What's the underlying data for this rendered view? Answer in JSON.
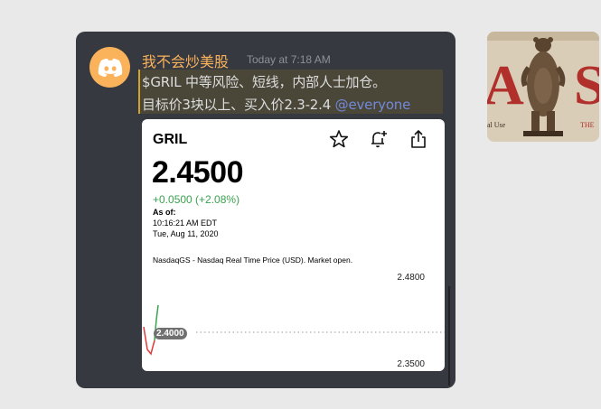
{
  "message": {
    "username": "我不会炒美股",
    "timestamp": "Today at 7:18 AM",
    "line1": "$GRIL 中等风险、短线，内部人士加仓。",
    "line2_text": "目标价3块以上、买入价2.3-2.4",
    "mention": "@everyone"
  },
  "stock_card": {
    "ticker": "GRIL",
    "price": "2.4500",
    "change": "+0.0500 (+2.08%)",
    "as_of_label": "As of:",
    "as_of_time": "10:16:21 AM EDT",
    "as_of_date": "Tue, Aug 11, 2020",
    "market_info": "NasdaqGS - Nasdaq Real Time Price (USD). Market open.",
    "y_high": "2.4800",
    "y_low": "2.3500",
    "current_tag": "2.4000"
  },
  "thumbnail": {
    "letter_left": "A",
    "letter_right": "S",
    "text_left": "al Use",
    "text_right": "THE"
  },
  "colors": {
    "username": "#fab25b",
    "mention": "#7289da",
    "change_positive": "#3aa34f",
    "line_red": "#e03a3a",
    "line_green": "#3aa34f"
  },
  "icons": [
    "discord-icon",
    "star-icon",
    "bell-plus-icon",
    "share-icon"
  ]
}
